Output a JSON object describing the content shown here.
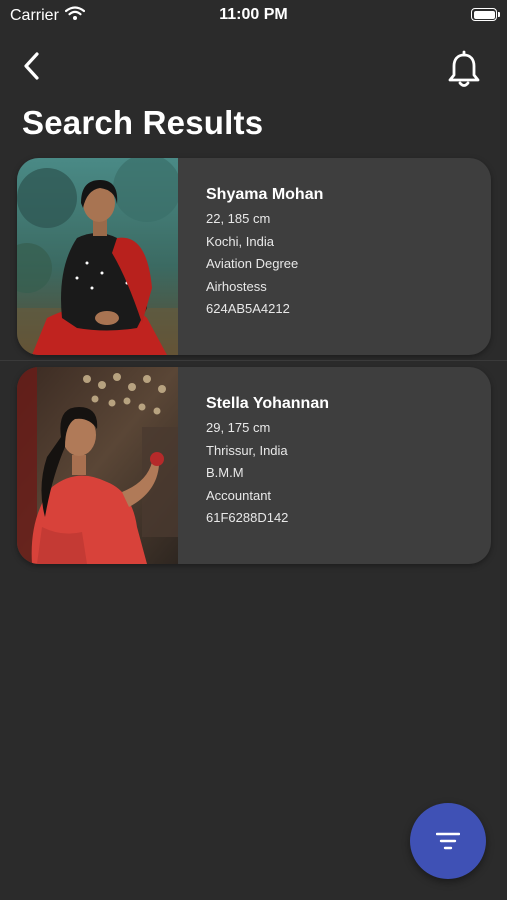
{
  "status_bar": {
    "carrier": "Carrier",
    "time": "11:00 PM",
    "icons": [
      "wifi-icon",
      "battery-icon"
    ]
  },
  "nav": {
    "back_icon": "chevron-left-icon",
    "notification_icon": "bell-icon"
  },
  "page": {
    "title": "Search Results"
  },
  "results": [
    {
      "name": "Shyama Mohan",
      "age_height": "22, 185 cm",
      "location": "Kochi, India",
      "education": "Aviation Degree",
      "profession": "Airhostess",
      "profile_id": "624AB5A4212"
    },
    {
      "name": "Stella Yohannan",
      "age_height": "29, 175 cm",
      "location": "Thrissur, India",
      "education": "B.M.M",
      "profession": "Accountant",
      "profile_id": "61F6288D142"
    }
  ],
  "fab": {
    "icon": "filter-icon",
    "color": "#3f51b5"
  },
  "colors": {
    "background": "#2b2b2b",
    "card": "#3e3e3e",
    "accent": "#3f51b5"
  }
}
